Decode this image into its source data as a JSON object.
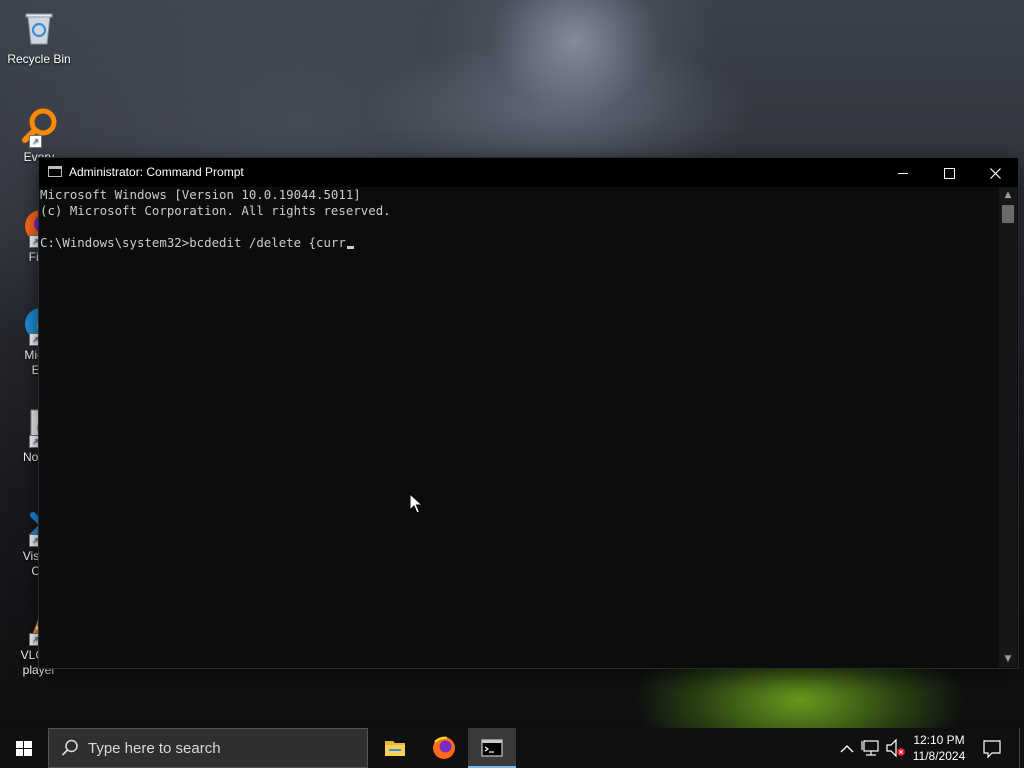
{
  "desktop": {
    "icons": [
      {
        "label": "Recycle Bin",
        "icon": "recycle-bin-icon"
      },
      {
        "label": "Every",
        "icon": "everything-search-icon"
      },
      {
        "label": "Fire",
        "icon": "firefox-icon"
      },
      {
        "label_line1": "Micro",
        "label_line2": "Ed",
        "icon": "edge-icon"
      },
      {
        "label": "Notep",
        "icon": "notepad-plus-plus-icon"
      },
      {
        "label_line1": "Visual",
        "label_line2": "Co",
        "icon": "vscode-icon"
      },
      {
        "label_line1": "VLC m",
        "label_line2": "player",
        "icon": "vlc-icon"
      }
    ]
  },
  "window": {
    "title": "Administrator: Command Prompt",
    "controls": {
      "minimize": "minimize",
      "maximize": "maximize",
      "close": "close"
    }
  },
  "console": {
    "lines": [
      "Microsoft Windows [Version 10.0.19044.5011]",
      "(c) Microsoft Corporation. All rights reserved.",
      "",
      "C:\\Windows\\system32>bcdedit /delete {curr"
    ]
  },
  "taskbar": {
    "search_placeholder": "Type here to search",
    "apps": [
      "file-explorer-icon",
      "firefox-icon",
      "command-prompt-icon"
    ],
    "clock": {
      "time": "12:10 PM",
      "date": "11/8/2024"
    }
  },
  "colors": {
    "console_bg": "#0c0c0c",
    "console_text": "#cccccc",
    "taskbar_bg": "#101010",
    "active_indicator": "#76b9ed"
  }
}
